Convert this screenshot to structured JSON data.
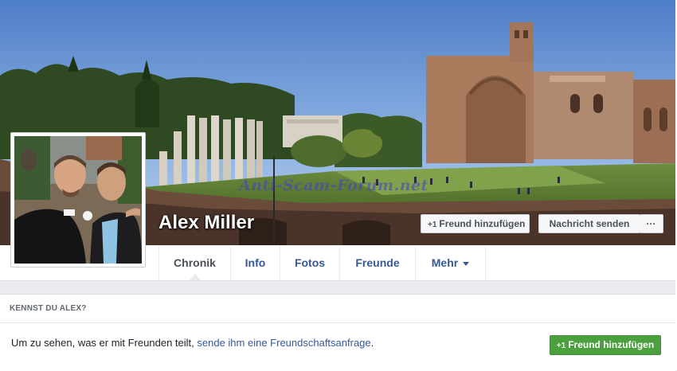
{
  "profile": {
    "name": "Alex Miller",
    "watermark": "Anti-Scam-Forum.net"
  },
  "actions": {
    "add_friend_label": "Freund hinzufügen",
    "add_friend_icon": "+1",
    "send_message_label": "Nachricht senden",
    "more_label": "···"
  },
  "tabs": [
    {
      "label": "Chronik",
      "active": true
    },
    {
      "label": "Info"
    },
    {
      "label": "Fotos"
    },
    {
      "label": "Freunde"
    },
    {
      "label": "Mehr"
    }
  ],
  "know_panel": {
    "title": "KENNST DU ALEX?",
    "text_before": "Um zu sehen, was er mit Freunden teilt,",
    "link_text": "sende ihm eine Freundschaftsanfrage",
    "text_after": ".",
    "button_label": "Freund hinzufügen",
    "button_icon": "+1"
  },
  "colors": {
    "link": "#365899",
    "green_button": "#4b9f3f",
    "page_bg": "#e9ebee"
  }
}
